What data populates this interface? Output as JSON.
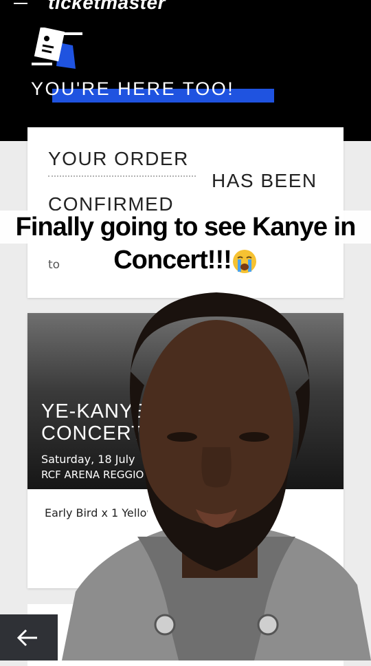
{
  "header": {
    "brand": "ticketmaster",
    "banner": "YOU'RE HERE TOO!"
  },
  "order": {
    "line1": "YOUR ORDER",
    "line2": "HAS BEEN",
    "line3": "CONFIRMED",
    "small": "to"
  },
  "caption": {
    "line1": "Finally going to see Kanye in",
    "line2": "Concert!!!"
  },
  "event": {
    "title_line1": "YE-KANYE",
    "title_line2": "CONCERT",
    "date": "Saturday, 18 July",
    "venue": "RCF ARENA REGGIO",
    "ticket": "Early Bird x 1 Yellow"
  },
  "colors": {
    "brand_blue": "#1f53e0",
    "header_bg": "#000000"
  },
  "icons": {
    "menu": "hamburger-menu-icon",
    "ticket": "ticket-icon",
    "emoji": "crying-face-emoji",
    "back": "back-arrow-icon"
  }
}
